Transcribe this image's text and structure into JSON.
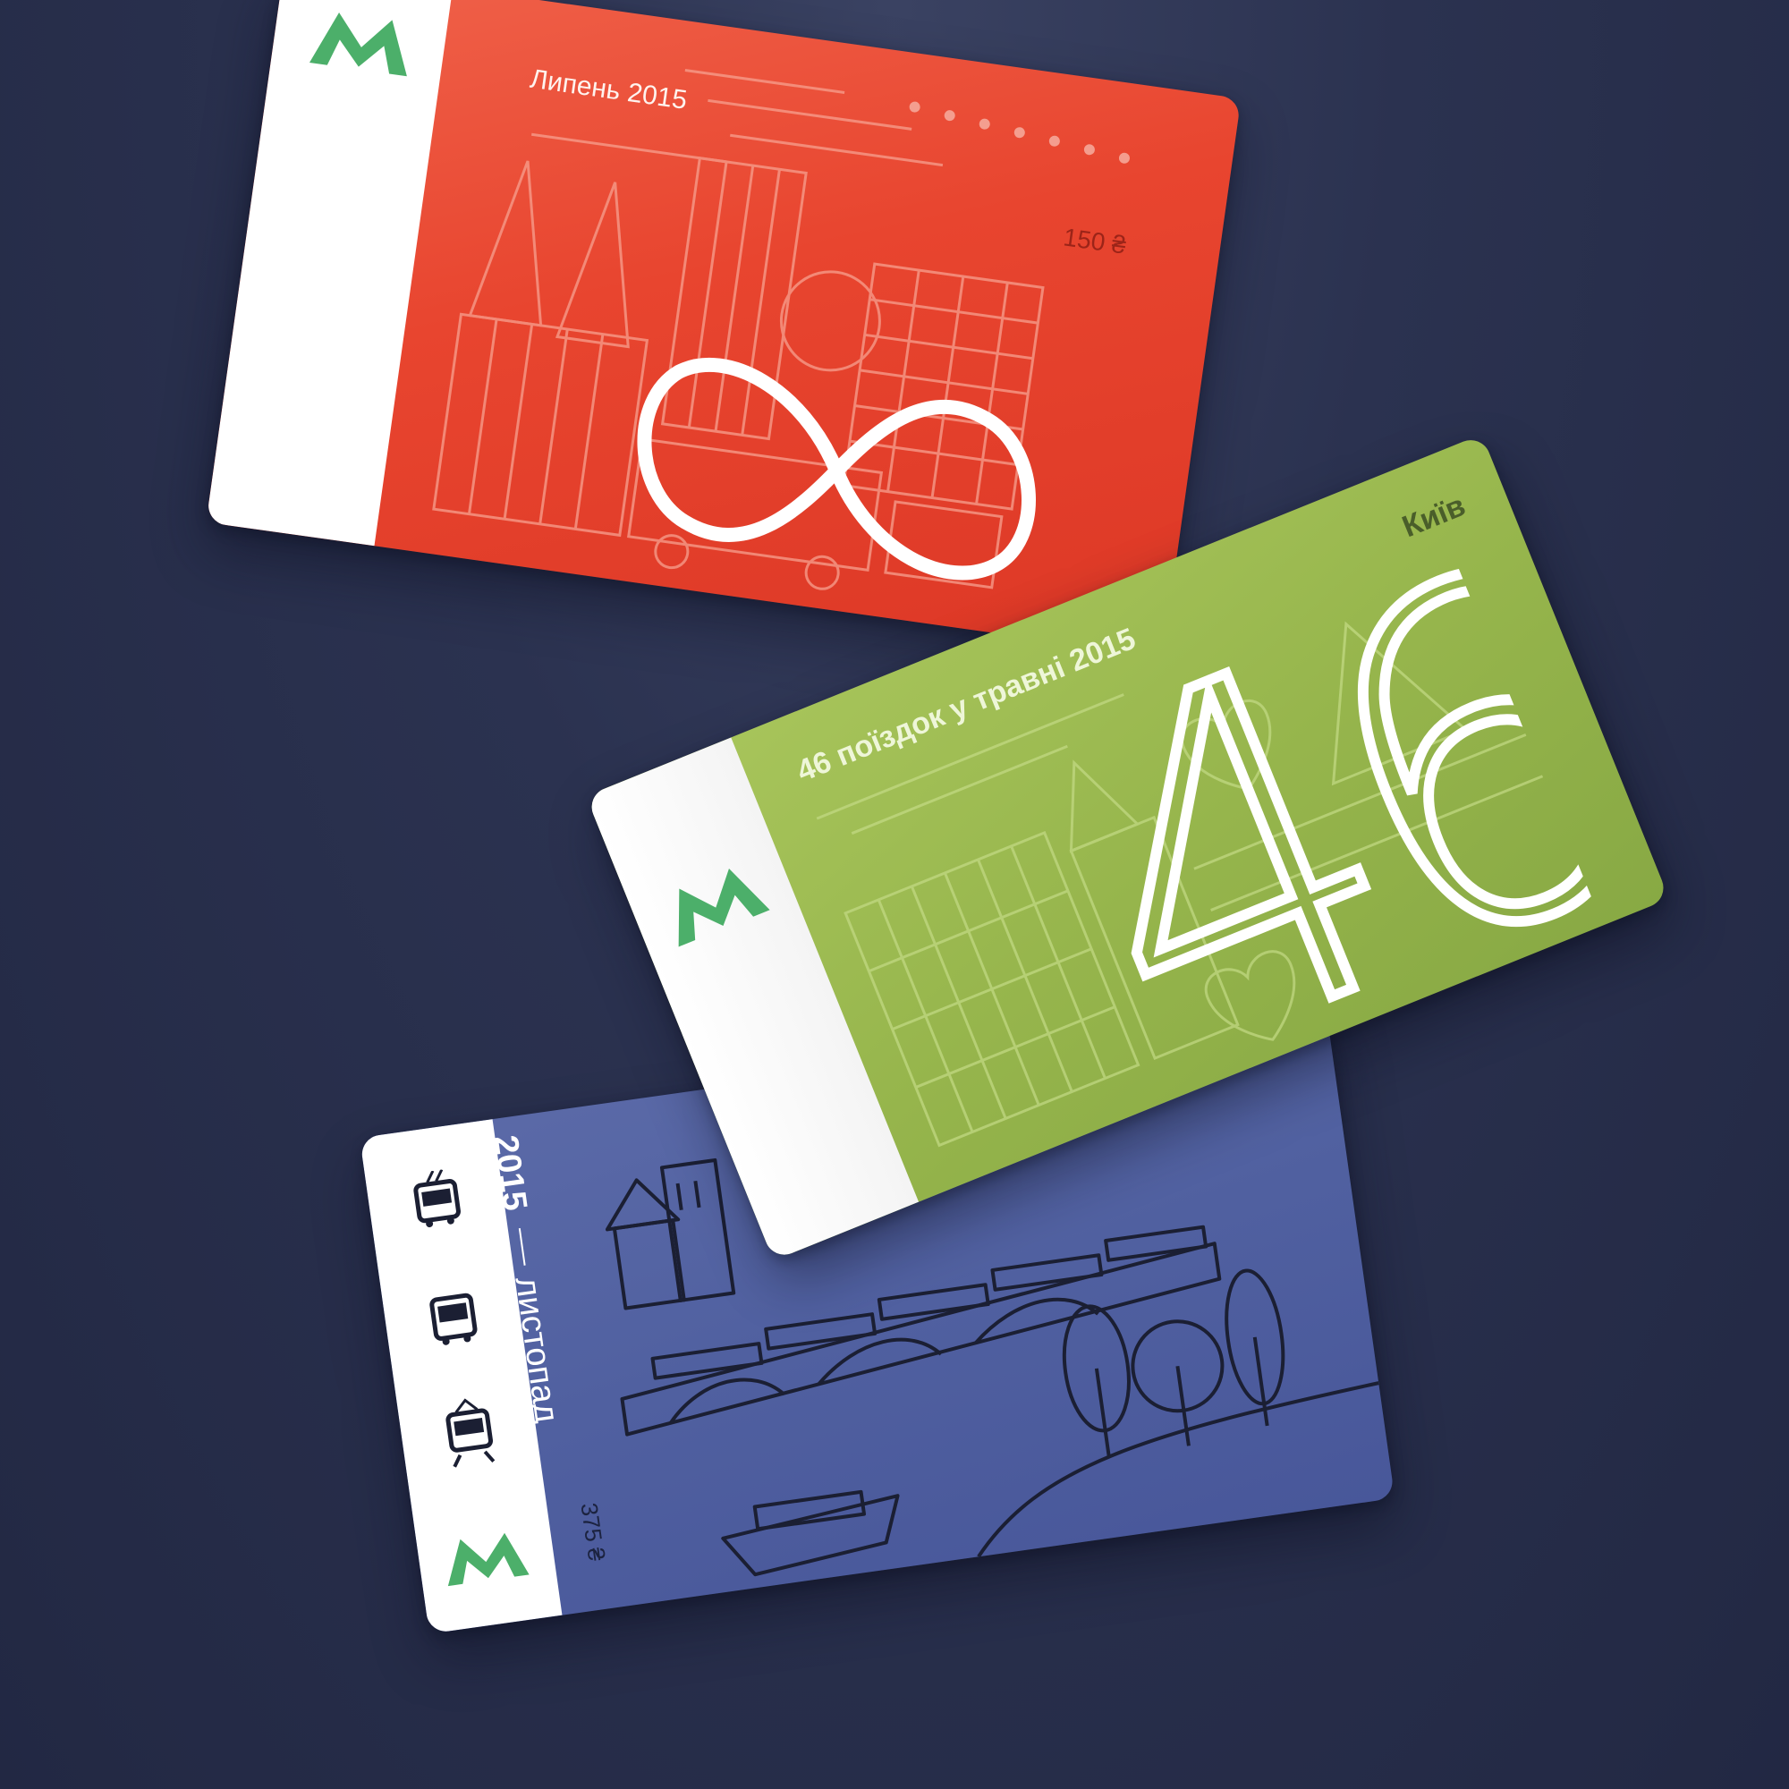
{
  "colors": {
    "background": "#2b3250",
    "metro_logo": "#4caf6a",
    "card_red": "#e8452f",
    "card_green": "#96b54c",
    "card_blue": "#5060a0"
  },
  "cards": {
    "red": {
      "title": "Липень 2015",
      "price": "150 ₴",
      "rides": "∞",
      "logo_icon": "metro-logo-icon"
    },
    "green": {
      "title": "46 поїздок у травні 2015",
      "city": "Київ",
      "big_number": "46",
      "logo_icon": "metro-logo-icon"
    },
    "blue": {
      "year": "2015",
      "month": "листопад",
      "price": "375 ₴",
      "transport_icons": [
        "trolleybus-icon",
        "bus-icon",
        "tram-icon"
      ],
      "logo_icon": "metro-logo-icon"
    }
  }
}
